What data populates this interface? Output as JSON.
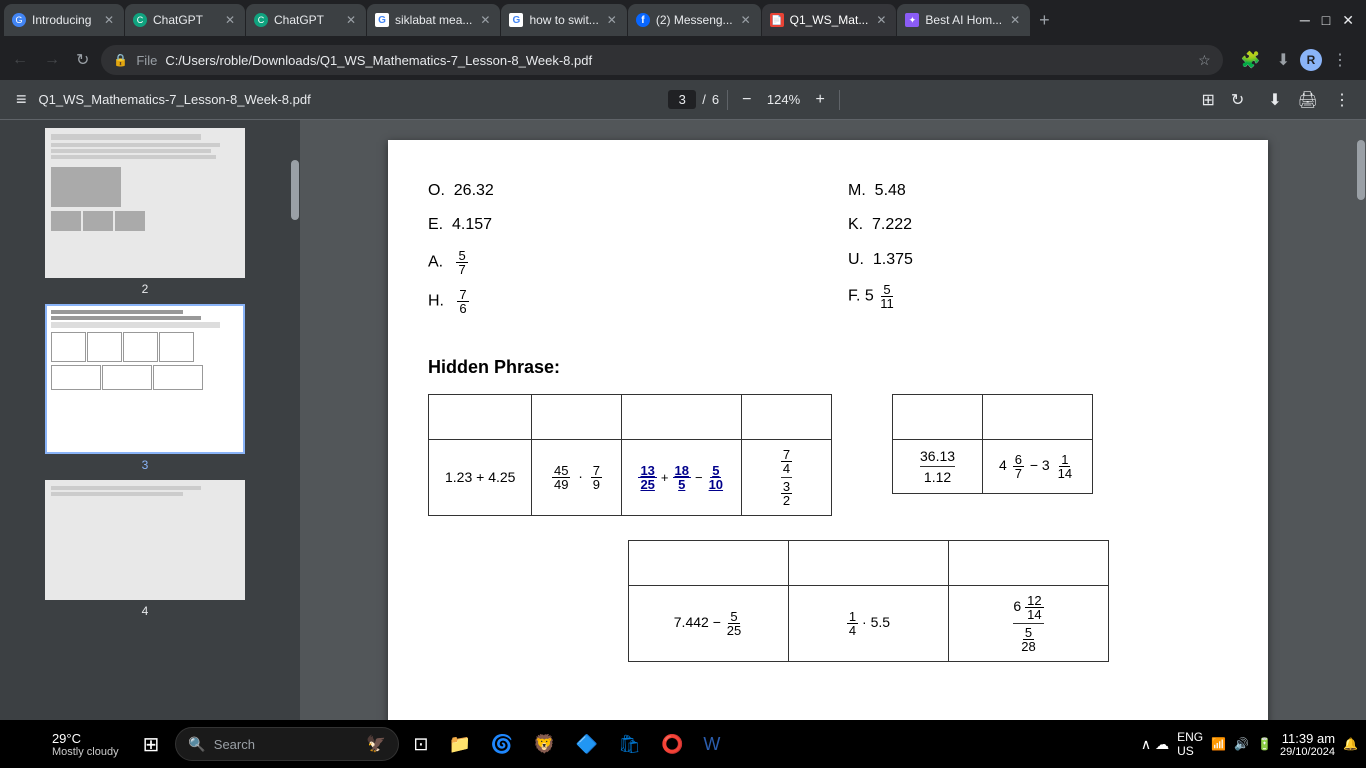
{
  "tabs": [
    {
      "id": 1,
      "label": "Introducing",
      "favicon": "🌐",
      "active": false,
      "color": "#8ab4f8"
    },
    {
      "id": 2,
      "label": "ChatGPT",
      "favicon": "🤖",
      "active": false,
      "color": "#10a37f"
    },
    {
      "id": 3,
      "label": "ChatGPT",
      "favicon": "🤖",
      "active": false,
      "color": "#10a37f"
    },
    {
      "id": 4,
      "label": "siklabat mea...",
      "favicon": "G",
      "active": false,
      "color": "#4285f4"
    },
    {
      "id": 5,
      "label": "how to swit...",
      "favicon": "G",
      "active": false,
      "color": "#4285f4"
    },
    {
      "id": 6,
      "label": "(2) Messeng...",
      "favicon": "f",
      "active": false,
      "color": "#0866ff"
    },
    {
      "id": 7,
      "label": "Q1_WS_Mat...",
      "favicon": "🔴",
      "active": true,
      "color": "#e84335"
    },
    {
      "id": 8,
      "label": "Best AI Hom...",
      "favicon": "✦",
      "active": false,
      "color": "#8b5cf6"
    }
  ],
  "address_bar": {
    "lock_icon": "🔒",
    "protocol": "File",
    "url": "C:/Users/roble/Downloads/Q1_WS_Mathematics-7_Lesson-8_Week-8.pdf"
  },
  "pdf_toolbar": {
    "menu_icon": "≡",
    "title": "Q1_WS_Mathematics-7_Lesson-8_Week-8.pdf",
    "current_page": "3",
    "total_pages": "6",
    "zoom": "124%"
  },
  "thumbnails": [
    {
      "page": 2,
      "selected": false
    },
    {
      "page": 3,
      "selected": true
    },
    {
      "page": 4,
      "selected": false
    }
  ],
  "pdf_content": {
    "answers": {
      "left_column": [
        {
          "letter": "O.",
          "value": "26.32"
        },
        {
          "letter": "E.",
          "value": "4.157"
        },
        {
          "letter": "A.",
          "value": "5/7"
        },
        {
          "letter": "H.",
          "value": "7/6"
        }
      ],
      "right_column": [
        {
          "letter": "M.",
          "value": "5.48"
        },
        {
          "letter": "K.",
          "value": "7.222"
        },
        {
          "letter": "U.",
          "value": "1.375"
        },
        {
          "letter": "F.",
          "value": "5 5/11"
        }
      ]
    },
    "hidden_phrase_label": "Hidden Phrase:",
    "table1": {
      "rows": [
        [
          "",
          "",
          "",
          ""
        ],
        [
          "1.23 + 4.25",
          "45/49 · 7/9",
          "13/25 + 18/5 − 5/10",
          "7/4 / 3/2"
        ]
      ]
    },
    "table2": {
      "rows": [
        [
          "",
          ""
        ],
        [
          "36.13 / 1.12",
          "4 6/7 − 3 1/14"
        ]
      ]
    },
    "table3": {
      "rows": [
        [
          "",
          "",
          ""
        ],
        [
          "7.442 − 5/25",
          "1/4 · 5.5",
          "6 12/14 / 5/28"
        ]
      ]
    }
  },
  "taskbar": {
    "weather_temp": "29°C",
    "weather_desc": "Mostly cloudy",
    "search_placeholder": "Search",
    "language": "ENG",
    "region": "US",
    "time": "11:39 am",
    "date": "29/10/2024",
    "notification_icon": "🔔"
  }
}
